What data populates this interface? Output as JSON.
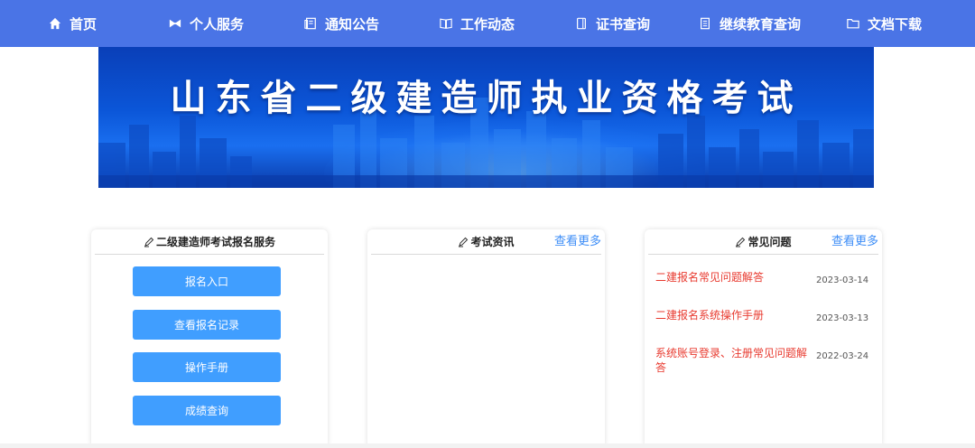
{
  "nav": {
    "items": [
      {
        "label": "首页",
        "icon": "home-icon"
      },
      {
        "label": "个人服务",
        "icon": "user-service-icon"
      },
      {
        "label": "通知公告",
        "icon": "notice-icon"
      },
      {
        "label": "工作动态",
        "icon": "book-icon"
      },
      {
        "label": "证书查询",
        "icon": "certificate-icon"
      },
      {
        "label": "继续教育查询",
        "icon": "document-icon"
      },
      {
        "label": "文档下载",
        "icon": "folder-icon"
      }
    ]
  },
  "banner": {
    "title": "山东省二级建造师执业资格考试"
  },
  "service_card": {
    "title": "二级建造师考试报名服务",
    "buttons": [
      "报名入口",
      "查看报名记录",
      "操作手册",
      "成绩查询"
    ]
  },
  "news_card": {
    "title": "考试资讯",
    "more": "查看更多"
  },
  "faq_card": {
    "title": "常见问题",
    "more": "查看更多",
    "items": [
      {
        "title": "二建报名常见问题解答",
        "date": "2023-03-14"
      },
      {
        "title": "二建报名系统操作手册",
        "date": "2023-03-13"
      },
      {
        "title": "系统账号登录、注册常见问题解答",
        "date": "2022-03-24"
      }
    ]
  },
  "colors": {
    "nav_bg": "#4a74e6",
    "button_bg": "#409eff",
    "link": "#3e8ef7",
    "faq_text": "#e83a2f"
  }
}
